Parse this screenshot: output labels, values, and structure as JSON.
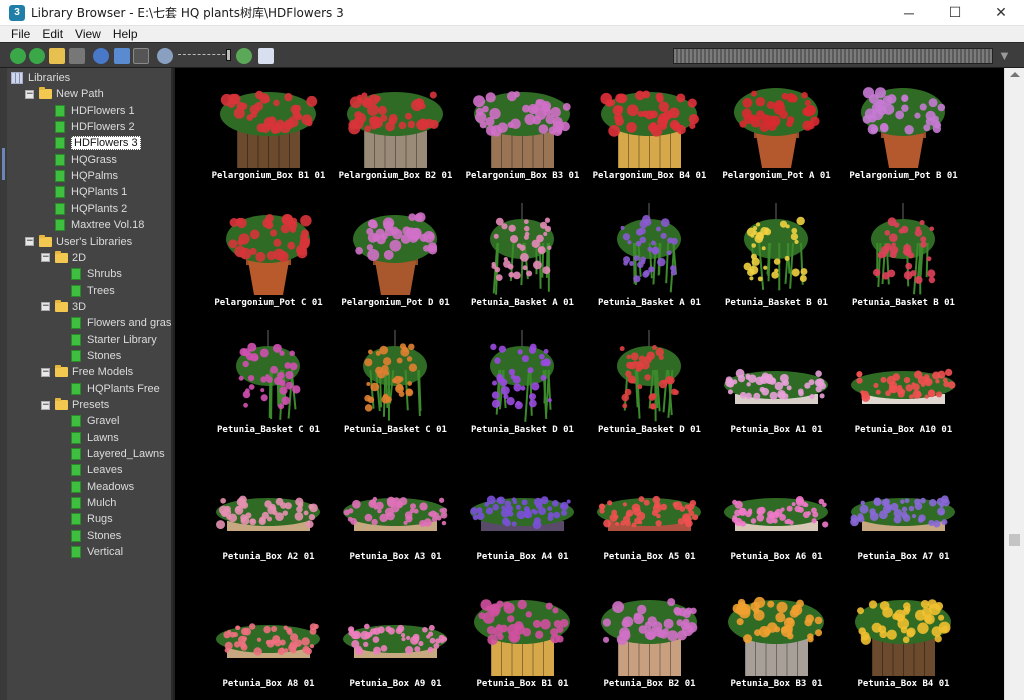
{
  "window": {
    "title": "Library Browser - E:\\七套 HQ plants树库\\HDFlowers 3",
    "app_icon": "3",
    "minimize": "─",
    "maximize": "☐",
    "close": "✕"
  },
  "menu": [
    "File",
    "Edit",
    "View",
    "Help"
  ],
  "toolbar": {
    "icons": [
      "back-icon",
      "forward-icon",
      "open-folder-icon",
      "stop-icon",
      "refresh-icon",
      "sort-icon",
      "rename-icon",
      "zoom-out-icon",
      "zoom-slider",
      "zoom-in-icon",
      "help-icon"
    ],
    "zoom_level": 0.9,
    "filter_icon": "▼"
  },
  "tree": [
    {
      "label": "Libraries",
      "icon": "libraries-icon",
      "expander": "",
      "level": 0
    },
    {
      "label": "New Path",
      "icon": "folder",
      "expander": "−",
      "level": 1
    },
    {
      "label": "HDFlowers 1",
      "icon": "leaf",
      "expander": "",
      "level": 2
    },
    {
      "label": "HDFlowers 2",
      "icon": "leaf",
      "expander": "",
      "level": 2
    },
    {
      "label": "HDFlowers 3",
      "icon": "leaf",
      "expander": "",
      "level": 2,
      "selected": true
    },
    {
      "label": "HQGrass",
      "icon": "leaf",
      "expander": "",
      "level": 2
    },
    {
      "label": "HQPalms",
      "icon": "leaf",
      "expander": "",
      "level": 2
    },
    {
      "label": "HQPlants 1",
      "icon": "leaf",
      "expander": "",
      "level": 2
    },
    {
      "label": "HQPlants 2",
      "icon": "leaf",
      "expander": "",
      "level": 2
    },
    {
      "label": "Maxtree Vol.18",
      "icon": "leaf",
      "expander": "",
      "level": 2
    },
    {
      "label": "User's Libraries",
      "icon": "folder",
      "expander": "−",
      "level": 1
    },
    {
      "label": "2D",
      "icon": "folder",
      "expander": "−",
      "level": 2
    },
    {
      "label": "Shrubs",
      "icon": "leaf",
      "expander": "",
      "level": 3
    },
    {
      "label": "Trees",
      "icon": "leaf",
      "expander": "",
      "level": 3
    },
    {
      "label": "3D",
      "icon": "folder",
      "expander": "−",
      "level": 2
    },
    {
      "label": "Flowers and grass",
      "icon": "leaf",
      "expander": "",
      "level": 3
    },
    {
      "label": "Starter Library",
      "icon": "leaf",
      "expander": "",
      "level": 3
    },
    {
      "label": "Stones",
      "icon": "leaf",
      "expander": "",
      "level": 3
    },
    {
      "label": "Free Models",
      "icon": "folder",
      "expander": "−",
      "level": 2
    },
    {
      "label": "HQPlants Free",
      "icon": "leaf",
      "expander": "",
      "level": 3
    },
    {
      "label": "Presets",
      "icon": "folder",
      "expander": "−",
      "level": 2
    },
    {
      "label": "Gravel",
      "icon": "leaf",
      "expander": "",
      "level": 3
    },
    {
      "label": "Lawns",
      "icon": "leaf",
      "expander": "",
      "level": 3
    },
    {
      "label": "Layered_Lawns",
      "icon": "leaf",
      "expander": "",
      "level": 3
    },
    {
      "label": "Leaves",
      "icon": "leaf",
      "expander": "",
      "level": 3
    },
    {
      "label": "Meadows",
      "icon": "leaf",
      "expander": "",
      "level": 3
    },
    {
      "label": "Mulch",
      "icon": "leaf",
      "expander": "",
      "level": 3
    },
    {
      "label": "Rugs",
      "icon": "leaf",
      "expander": "",
      "level": 3
    },
    {
      "label": "Stones",
      "icon": "leaf",
      "expander": "",
      "level": 3
    },
    {
      "label": "Vertical",
      "icon": "leaf",
      "expander": "",
      "level": 3
    }
  ],
  "items": [
    {
      "name": "Pelargonium_Box B1 01",
      "kind": "box",
      "flower": "#d8343a",
      "pot": "#6b4a2e"
    },
    {
      "name": "Pelargonium_Box B2 01",
      "kind": "box",
      "flower": "#d8343a",
      "pot": "#9a8a78"
    },
    {
      "name": "Pelargonium_Box B3 01",
      "kind": "box",
      "flower": "#d070c8",
      "pot": "#9a7555"
    },
    {
      "name": "Pelargonium_Box B4 01",
      "kind": "box",
      "flower": "#e0303a",
      "pot": "#d6a84a"
    },
    {
      "name": "Pelargonium_Pot A 01",
      "kind": "pot",
      "flower": "#d82a30",
      "pot": "#b4582e"
    },
    {
      "name": "Pelargonium_Pot B 01",
      "kind": "pot",
      "flower": "#c77ad4",
      "pot": "#b4582e"
    },
    {
      "name": "Pelargonium_Pot C 01",
      "kind": "pot",
      "flower": "#d8343a",
      "pot": "#b95a2c"
    },
    {
      "name": "Pelargonium_Pot D 01",
      "kind": "pot",
      "flower": "#d070c8",
      "pot": "#a8582c"
    },
    {
      "name": "Petunia_Basket A 01",
      "kind": "basket",
      "flower": "#e58ab8",
      "pot": "#3c8a2c"
    },
    {
      "name": "Petunia_Basket A 01",
      "kind": "basket",
      "flower": "#8a5ad0",
      "pot": "#3c8a2c"
    },
    {
      "name": "Petunia_Basket B 01",
      "kind": "basket",
      "flower": "#f0d040",
      "pot": "#3c8a2c"
    },
    {
      "name": "Petunia_Basket B 01",
      "kind": "basket",
      "flower": "#e0405a",
      "pot": "#3c8a2c"
    },
    {
      "name": "Petunia_Basket C 01",
      "kind": "basket",
      "flower": "#d050b0",
      "pot": "#3c8a2c"
    },
    {
      "name": "Petunia_Basket C 01",
      "kind": "basket",
      "flower": "#e08030",
      "pot": "#3c8a2c"
    },
    {
      "name": "Petunia_Basket D 01",
      "kind": "basket",
      "flower": "#9a4ae0",
      "pot": "#3c8a2c"
    },
    {
      "name": "Petunia_Basket D 01",
      "kind": "basket",
      "flower": "#e04040",
      "pot": "#3c8a2c"
    },
    {
      "name": "Petunia_Box A1 01",
      "kind": "trough",
      "flower": "#e8a0d8",
      "pot": "#d8d0c8"
    },
    {
      "name": "Petunia_Box A10 01",
      "kind": "trough",
      "flower": "#f05050",
      "pot": "#e0d8d0"
    },
    {
      "name": "Petunia_Box A2 01",
      "kind": "trough",
      "flower": "#e690b0",
      "pot": "#c8a880"
    },
    {
      "name": "Petunia_Box A3 01",
      "kind": "trough",
      "flower": "#e070b8",
      "pot": "#c8a880"
    },
    {
      "name": "Petunia_Box A4 01",
      "kind": "trough",
      "flower": "#7a50d8",
      "pot": "#5a4a6a"
    },
    {
      "name": "Petunia_Box A5 01",
      "kind": "trough",
      "flower": "#f05050",
      "pot": "#b05040"
    },
    {
      "name": "Petunia_Box A6 01",
      "kind": "trough",
      "flower": "#f078c8",
      "pot": "#d8c8b8"
    },
    {
      "name": "Petunia_Box A7 01",
      "kind": "trough",
      "flower": "#8a68d8",
      "pot": "#c8a880"
    },
    {
      "name": "Petunia_Box A8 01",
      "kind": "trough",
      "flower": "#f07080",
      "pot": "#c8a880"
    },
    {
      "name": "Petunia_Box A9 01",
      "kind": "trough",
      "flower": "#f080c0",
      "pot": "#c8a880"
    },
    {
      "name": "Petunia_Box B1 01",
      "kind": "box",
      "flower": "#d050a0",
      "pot": "#d6a84a"
    },
    {
      "name": "Petunia_Box B2 01",
      "kind": "box",
      "flower": "#d070c8",
      "pot": "#c8a080"
    },
    {
      "name": "Petunia_Box B3 01",
      "kind": "box",
      "flower": "#f0a030",
      "pot": "#a8a098"
    },
    {
      "name": "Petunia_Box B4 01",
      "kind": "box",
      "flower": "#f0c030",
      "pot": "#6b4a2e"
    }
  ]
}
